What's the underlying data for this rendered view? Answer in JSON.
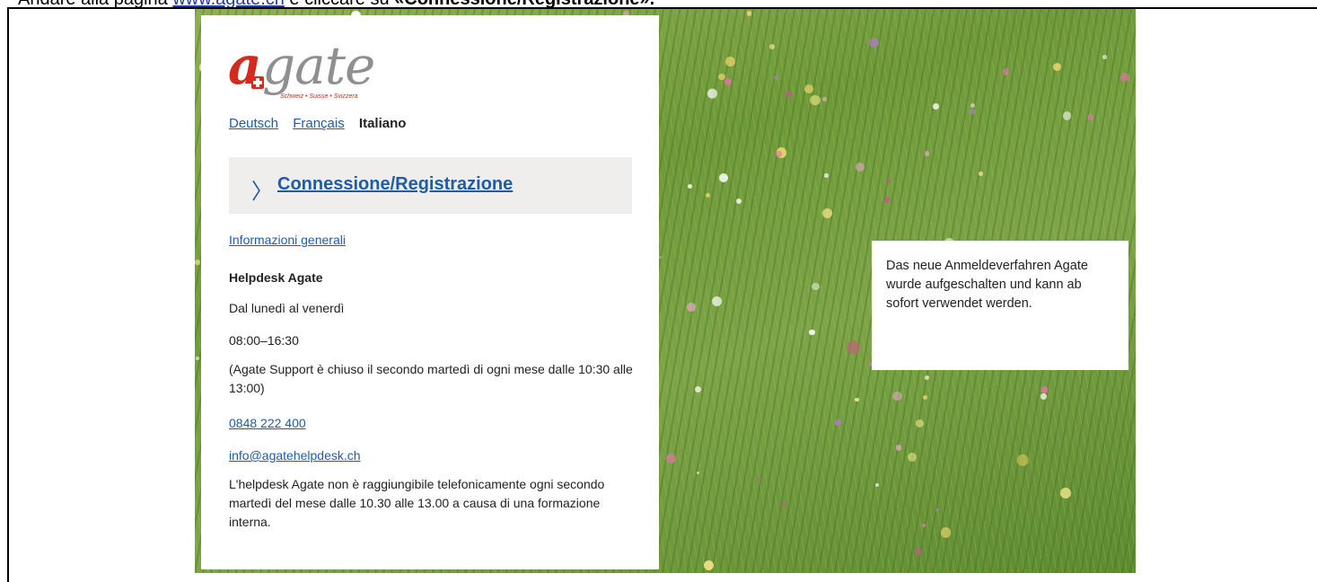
{
  "instruction": {
    "prefix": "Andare alla pagina ",
    "link": "www.agate.ch",
    "middle": " e cliccare su ",
    "bold": "«Connessione/Registrazione»."
  },
  "logo": {
    "word": "gate",
    "initial": "a",
    "subtitle": "Schweiz • Suisse • Svizzera"
  },
  "languages": {
    "de": "Deutsch",
    "fr": "Français",
    "it": "Italiano"
  },
  "login": {
    "label": "Connessione/Registrazione",
    "icon": "chevron-right-icon"
  },
  "info": {
    "general_link": "Informazioni generali",
    "helpdesk_title": "Helpdesk Agate",
    "days": "Dal lunedì al venerdì",
    "hours": "08:00–16:30",
    "closure_note": "(Agate Support è chiuso il secondo martedì di ogni mese dalle 10:30 alle 13:00)",
    "phone": "0848 222 400",
    "email": "info@agatehelpdesk.ch",
    "training_note": "L'helpdesk Agate non è raggiungibile telefonicamente ogni secondo martedì del mese dalle 10.30 alle 13.00 a causa di una formazione interna."
  },
  "notice": {
    "text": "Das neue Anmeldeverfahren Agate wurde aufgeschalten und kann ab sofort verwendet werden."
  },
  "colors": {
    "link": "#1f5ca8",
    "brand_red": "#d52b1e",
    "logo_gray": "#8e8f91",
    "box_bg": "#f0eeec"
  }
}
